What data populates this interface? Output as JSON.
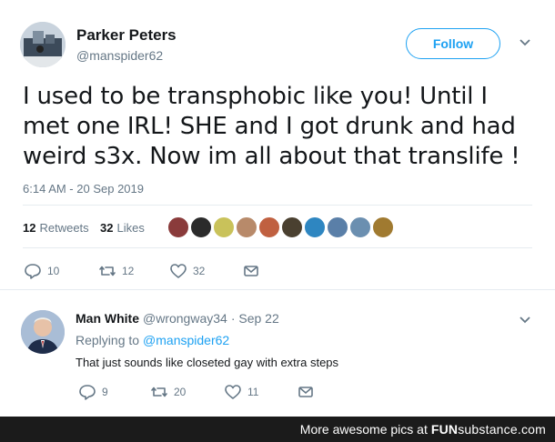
{
  "tweet": {
    "author_name": "Parker Peters",
    "author_handle": "@manspider62",
    "follow_label": "Follow",
    "text": "I used to be transphobic like you! Until I met one IRL! SHE and I got drunk and had weird s3x. Now im all about that translife !",
    "timestamp": "6:14 AM - 20 Sep 2019",
    "retweets_count": "12",
    "retweets_label": "Retweets",
    "likes_count": "32",
    "likes_label": "Likes",
    "actions": {
      "replies": "10",
      "retweets": "12",
      "likes": "32"
    }
  },
  "reply": {
    "author_name": "Man White",
    "author_handle": "@wrongway34",
    "date": "· Sep 22",
    "replying_to_label": "Replying to",
    "replying_to_handle": "@manspider62",
    "text": "That just sounds like closeted gay with extra steps",
    "actions": {
      "replies": "9",
      "retweets": "20",
      "likes": "11"
    }
  },
  "footer": {
    "text": "More awesome pics at",
    "brand_bold": "FUN",
    "brand_rest": "substance",
    "brand_suffix": ".com"
  },
  "colors": {
    "accent": "#1da1f2",
    "text": "#14171a",
    "muted": "#657786",
    "footer_bg": "#1b1b1b"
  },
  "liker_avatar_colors": [
    "#8a3b3b",
    "#2b2b2b",
    "#c9c25a",
    "#b88a6a",
    "#c06040",
    "#4a4030",
    "#2e86c1",
    "#5a7fa8",
    "#6b8fb0",
    "#a07a30"
  ]
}
